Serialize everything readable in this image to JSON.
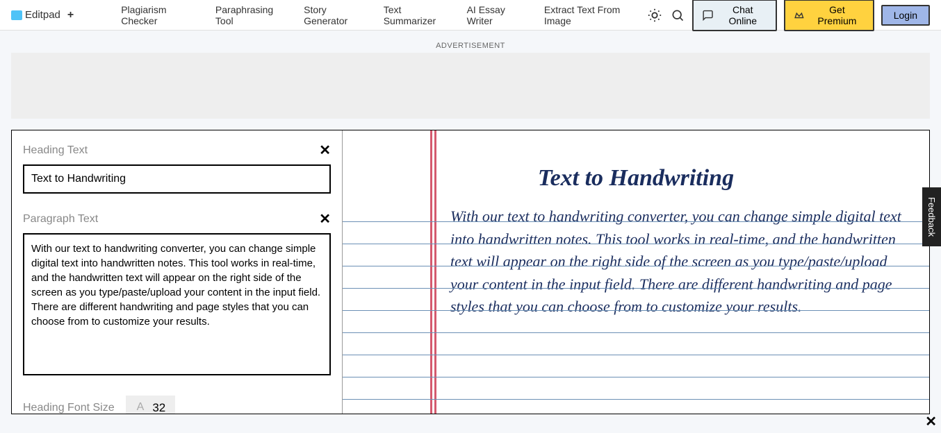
{
  "header": {
    "brand": "Editpad",
    "plus": "+",
    "nav": {
      "plagiarism": "Plagiarism Checker",
      "paraphrasing": "Paraphrasing Tool",
      "story": "Story Generator",
      "summarizer": "Text Summarizer",
      "essay": "AI Essay Writer",
      "extract": "Extract Text From Image"
    },
    "chat": "Chat Online",
    "premium": "Get Premium",
    "login": "Login"
  },
  "ad_label": "ADVERTISEMENT",
  "editor": {
    "heading_label": "Heading Text",
    "heading_value": "Text to Handwriting",
    "paragraph_label": "Paragraph Text",
    "paragraph_value": "With our text to handwriting converter, you can change simple digital text into handwritten notes. This tool works in real-time, and the handwritten text will appear on the right side of the screen as you type/paste/upload your content in the input field. There are different handwriting and page styles that you can choose from to customize your results.",
    "fontsize_label": "Heading Font Size",
    "fontsize_value": "32"
  },
  "output": {
    "heading": "Text to Handwriting",
    "body": "With our text to handwriting converter, you can change simple digital text into handwritten notes. This tool works in real-time, and the handwritten text will appear on the right side of the screen as you type/paste/upload your content in the input field. There are different handwriting and page styles that you can choose from to customize your results."
  },
  "feedback": "Feedback"
}
